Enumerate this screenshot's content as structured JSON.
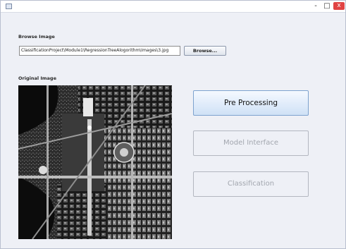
{
  "window": {
    "minimize_glyph": "-",
    "maximize_glyph": "□",
    "close_glyph": "x"
  },
  "browse": {
    "label": "Browse Image",
    "path_value": "ClassificationProject\\Module1\\RegressionTreeAlogorithm\\Images\\3.jpg",
    "button_label": "Browse..."
  },
  "original": {
    "label": "Original Image"
  },
  "actions": {
    "pre_processing": "Pre Processing",
    "model_interface": "Model Interface",
    "classification": "Classification"
  },
  "colors": {
    "window_bg": "#eef0f6",
    "primary_button_border": "#7da2ce",
    "disabled_text": "#a2a6ae",
    "close_button": "#e04343"
  }
}
